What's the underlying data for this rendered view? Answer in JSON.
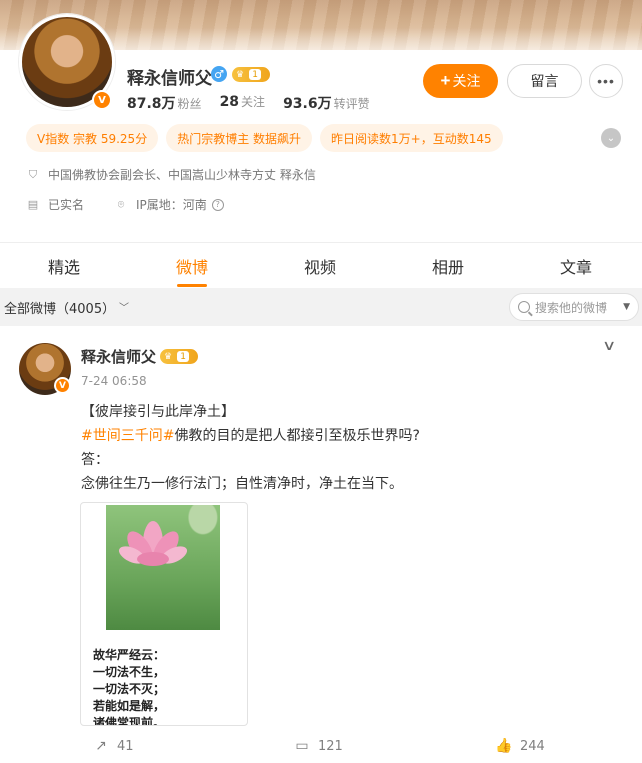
{
  "profile": {
    "name": "释永信师父",
    "gender_symbol": "♂",
    "level": "1",
    "verified_badge": "V",
    "stats": [
      {
        "value": "87.8万",
        "label": "粉丝"
      },
      {
        "value": "28",
        "label": "关注"
      },
      {
        "value": "93.6万",
        "label": "转评赞"
      }
    ],
    "follow_label": "关注",
    "message_label": "留言",
    "more_label": "•••",
    "tags": [
      "V指数 宗教 59.25分",
      "热门宗教博主 数据飙升",
      "昨日阅读数1万+，互动数145"
    ],
    "description": "中国佛教协会副会长、中国嵩山少林寺方丈 释永信",
    "real_name_status": "已实名",
    "ip_location": "IP属地：河南"
  },
  "tabs": [
    "精选",
    "微博",
    "视频",
    "相册",
    "文章"
  ],
  "active_tab": "微博",
  "filter": {
    "label": "全部微博（4005）",
    "search_placeholder": "搜索他的微博"
  },
  "post": {
    "author": "释永信师父",
    "level": "1",
    "time": "7-24 06:58",
    "title": "【彼岸接引与此岸净土】",
    "hashtag": "#世间三千问#",
    "question": "佛教的目的是把人都接引至极乐世界吗?",
    "answer_label": "答：",
    "answer": "念佛往生乃一修行法门；自性清净时，净土在当下。",
    "image_text": [
      "故华严经云：",
      "一切法不生，",
      "一切法不灭；",
      "若能如是解，",
      "诸佛常现前。"
    ],
    "reposts": "41",
    "comments": "121",
    "likes": "244"
  },
  "colors": {
    "accent": "#ff8200",
    "tag_bg": "#fff3e6",
    "verified": "#ff8200",
    "male": "#45a5f2"
  },
  "icons": {
    "location": "shield-icon",
    "real_name": "id-card-icon",
    "ip": "location-icon",
    "repost": "repost-icon",
    "comment": "comment-icon",
    "like": "thumbs-up-icon"
  }
}
